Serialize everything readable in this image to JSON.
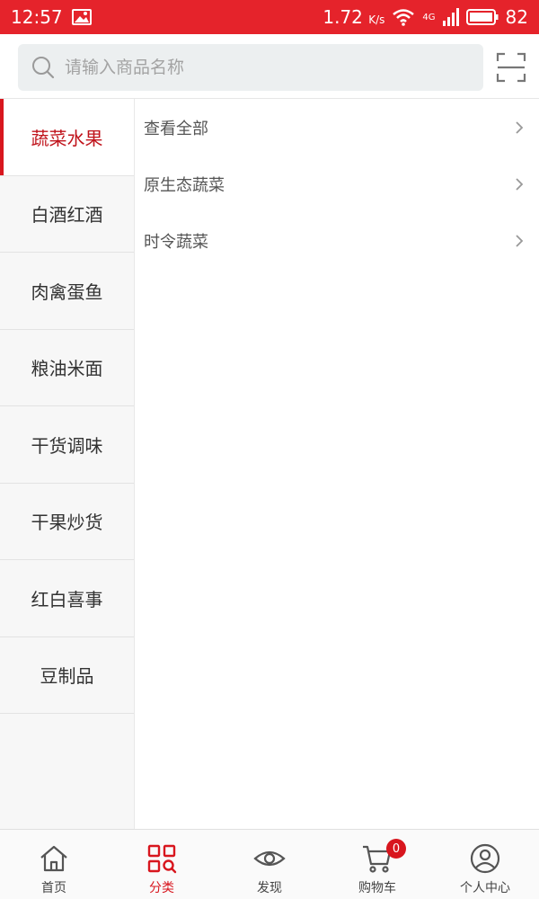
{
  "status": {
    "time": "12:57",
    "speed": "1.72",
    "speed_unit": "K/s",
    "network": "4G",
    "battery": "82"
  },
  "search": {
    "placeholder": "请输入商品名称"
  },
  "sidebar": {
    "items": [
      {
        "label": "蔬菜水果",
        "active": true
      },
      {
        "label": "白酒红酒"
      },
      {
        "label": "肉禽蛋鱼"
      },
      {
        "label": "粮油米面"
      },
      {
        "label": "干货调味"
      },
      {
        "label": "干果炒货"
      },
      {
        "label": "红白喜事"
      },
      {
        "label": "豆制品"
      }
    ]
  },
  "subcategories": [
    {
      "label": "查看全部"
    },
    {
      "label": "原生态蔬菜"
    },
    {
      "label": "时令蔬菜"
    }
  ],
  "tabbar": {
    "items": [
      {
        "label": "首页",
        "icon": "home-icon"
      },
      {
        "label": "分类",
        "icon": "category-icon",
        "active": true
      },
      {
        "label": "发现",
        "icon": "eye-icon"
      },
      {
        "label": "购物车",
        "icon": "cart-icon",
        "badge": "0"
      },
      {
        "label": "个人中心",
        "icon": "user-icon"
      }
    ]
  },
  "colors": {
    "accent": "#d8161e",
    "status_bar": "#e5232b"
  }
}
